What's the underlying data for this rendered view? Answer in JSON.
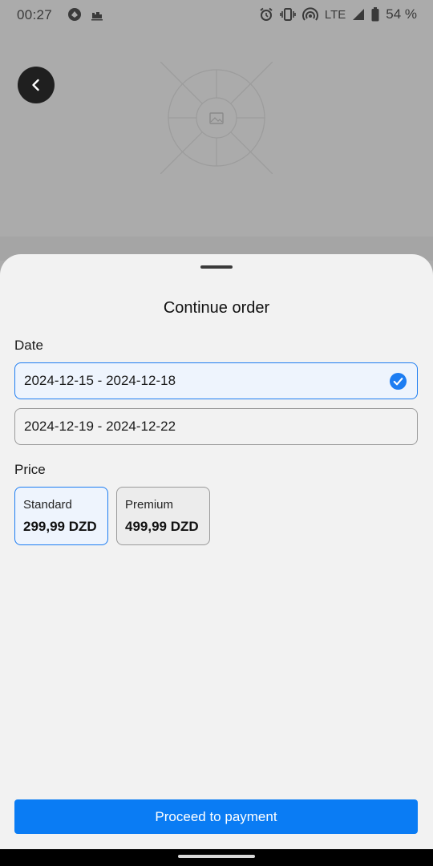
{
  "status_bar": {
    "time": "00:27",
    "network": "LTE",
    "battery": "54 %",
    "icons": [
      "app-notification-icon",
      "boat-notification-icon",
      "alarm-icon",
      "vibrate-icon",
      "hotspot-icon",
      "signal-icon",
      "battery-icon"
    ]
  },
  "hero": {
    "image_icon": "image-placeholder-icon",
    "back_icon": "chevron-left-icon"
  },
  "sheet": {
    "title": "Continue order",
    "date_label": "Date",
    "dates": [
      {
        "text": "2024-12-15 - 2024-12-18",
        "selected": true
      },
      {
        "text": "2024-12-19 - 2024-12-22",
        "selected": false
      }
    ],
    "price_label": "Price",
    "prices": [
      {
        "name": "Standard",
        "value": "299,99 DZD",
        "selected": true
      },
      {
        "name": "Premium",
        "value": "499,99 DZD",
        "selected": false
      }
    ],
    "proceed_label": "Proceed to payment"
  },
  "colors": {
    "accent": "#0a7cf4",
    "scrim": "#ababab",
    "sheet_bg": "#f2f2f2"
  }
}
